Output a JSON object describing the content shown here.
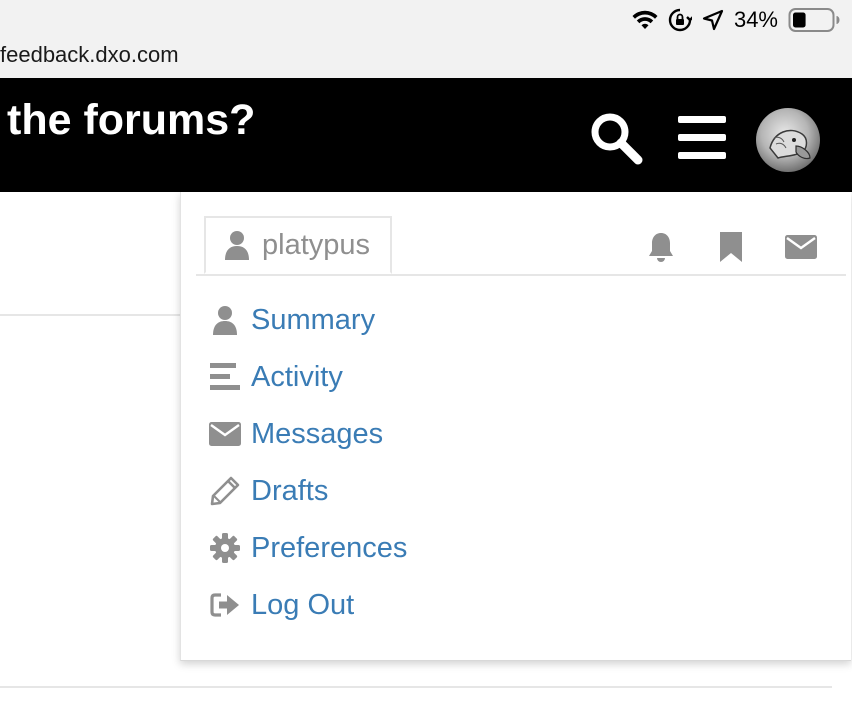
{
  "status_bar": {
    "battery_percent": "34%",
    "battery_level": 0.34,
    "icons": [
      "wifi-icon",
      "rotation-lock-icon",
      "location-arrow-icon",
      "battery-icon"
    ]
  },
  "url_bar": {
    "url": "feedback.dxo.com"
  },
  "header": {
    "title": "the forums?",
    "icons": [
      "search-icon",
      "hamburger-menu-icon",
      "avatar"
    ]
  },
  "user_menu": {
    "username": "platypus",
    "tab_icons": [
      "bell-icon",
      "bookmark-icon",
      "envelope-icon"
    ],
    "items": [
      {
        "label": "Summary",
        "icon": "user-icon"
      },
      {
        "label": "Activity",
        "icon": "activity-lines-icon"
      },
      {
        "label": "Messages",
        "icon": "envelope-icon"
      },
      {
        "label": "Drafts",
        "icon": "pencil-icon"
      },
      {
        "label": "Preferences",
        "icon": "gear-icon"
      },
      {
        "label": "Log Out",
        "icon": "sign-out-icon"
      }
    ]
  },
  "colors": {
    "header_bg": "#000000",
    "link": "#3a7cb5",
    "icon_gray": "#8f8f8f",
    "status_bg": "#f2f2f2"
  }
}
